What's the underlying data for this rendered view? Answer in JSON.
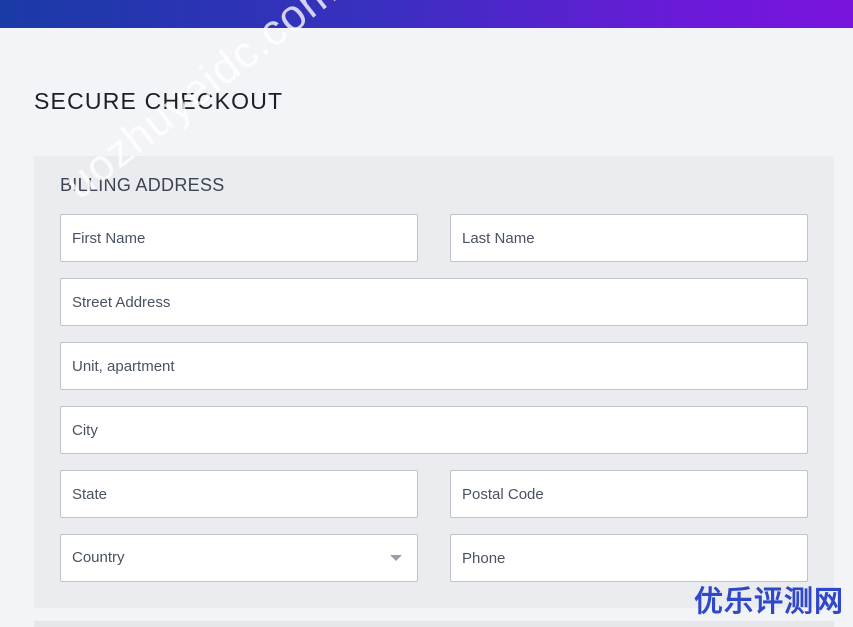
{
  "page": {
    "title": "SECURE CHECKOUT"
  },
  "billing": {
    "section_title": "BILLING ADDRESS",
    "first_name_placeholder": "First Name",
    "last_name_placeholder": "Last Name",
    "street_placeholder": "Street Address",
    "unit_placeholder": "Unit, apartment",
    "city_placeholder": "City",
    "state_placeholder": "State",
    "postal_placeholder": "Postal Code",
    "country_value": "Country",
    "phone_placeholder": "Phone"
  },
  "watermarks": {
    "diagonal": "uozhuyeidc.com",
    "corner": "优乐评测网"
  },
  "colors": {
    "header_gradient_start": "#1a3aa6",
    "header_gradient_end": "#7a14dd",
    "page_background": "#f3f4f7",
    "panel_background": "#ebecef",
    "corner_watermark": "#2f47c9"
  }
}
